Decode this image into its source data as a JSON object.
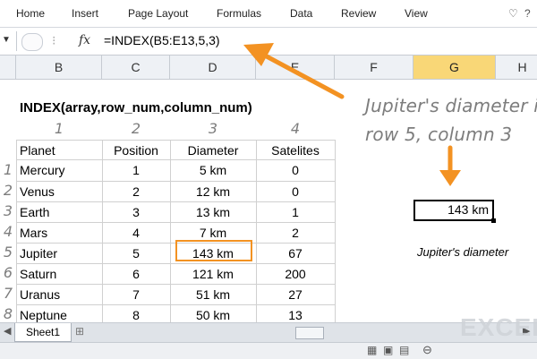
{
  "ribbon": {
    "tabs": [
      "Home",
      "Insert",
      "Page Layout",
      "Formulas",
      "Data",
      "Review",
      "View"
    ]
  },
  "formula_bar": {
    "fx_label": "fx",
    "formula": "=INDEX(B5:E13,5,3)"
  },
  "columns": [
    "B",
    "C",
    "D",
    "E",
    "F",
    "G",
    "H"
  ],
  "selected_column": "G",
  "sheet": {
    "heading": "INDEX(array,row_num,column_num)",
    "column_numbers": [
      "1",
      "2",
      "3",
      "4"
    ],
    "table": {
      "headers": [
        "Planet",
        "Position",
        "Diameter",
        "Satelites"
      ],
      "rows": [
        [
          "Mercury",
          "1",
          "5 km",
          "0"
        ],
        [
          "Venus",
          "2",
          "12 km",
          "0"
        ],
        [
          "Earth",
          "3",
          "13 km",
          "1"
        ],
        [
          "Mars",
          "4",
          "7 km",
          "2"
        ],
        [
          "Jupiter",
          "5",
          "143 km",
          "67"
        ],
        [
          "Saturn",
          "6",
          "121 km",
          "200"
        ],
        [
          "Uranus",
          "7",
          "51 km",
          "27"
        ],
        [
          "Neptune",
          "8",
          "50 km",
          "13"
        ]
      ],
      "row_numbers": [
        "1",
        "2",
        "3",
        "4",
        "5",
        "6",
        "7",
        "8"
      ]
    },
    "result_value": "143 km",
    "result_caption": "Jupiter's diameter"
  },
  "annotation": {
    "line1": "Jupiter's diameter is",
    "line2": "row 5, column 3"
  },
  "tabs": {
    "sheet_name": "Sheet1"
  },
  "watermark": "EXCEL",
  "colors": {
    "accent_orange": "#f39222",
    "header_fill": "#eef1f5",
    "selected_header": "#f9d777",
    "grid": "#d0d0d0"
  }
}
